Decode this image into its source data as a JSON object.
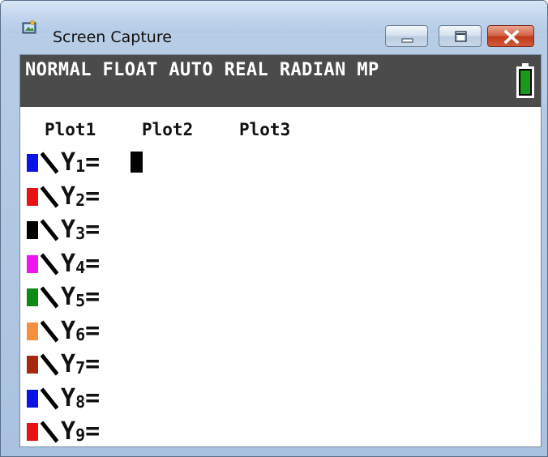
{
  "window": {
    "title": "Screen Capture"
  },
  "statusbar": {
    "text": "NORMAL FLOAT AUTO REAL RADIAN MP",
    "battery_color": "#1a9a1a"
  },
  "plots": [
    "Plot1",
    "Plot2",
    "Plot3"
  ],
  "equations": [
    {
      "label": "Y",
      "sub": "1",
      "equals": "=",
      "color": "#0a14e6",
      "selected": true
    },
    {
      "label": "Y",
      "sub": "2",
      "equals": "=",
      "color": "#e81414",
      "selected": false
    },
    {
      "label": "Y",
      "sub": "3",
      "equals": "=",
      "color": "#000000",
      "selected": false
    },
    {
      "label": "Y",
      "sub": "4",
      "equals": "=",
      "color": "#f014f0",
      "selected": false
    },
    {
      "label": "Y",
      "sub": "5",
      "equals": "=",
      "color": "#0e8a14",
      "selected": false
    },
    {
      "label": "Y",
      "sub": "6",
      "equals": "=",
      "color": "#f5903c",
      "selected": false
    },
    {
      "label": "Y",
      "sub": "7",
      "equals": "=",
      "color": "#a8280f",
      "selected": false
    },
    {
      "label": "Y",
      "sub": "8",
      "equals": "=",
      "color": "#0a14e6",
      "selected": false
    },
    {
      "label": "Y",
      "sub": "9",
      "equals": "=",
      "color": "#e81414",
      "selected": false
    }
  ]
}
